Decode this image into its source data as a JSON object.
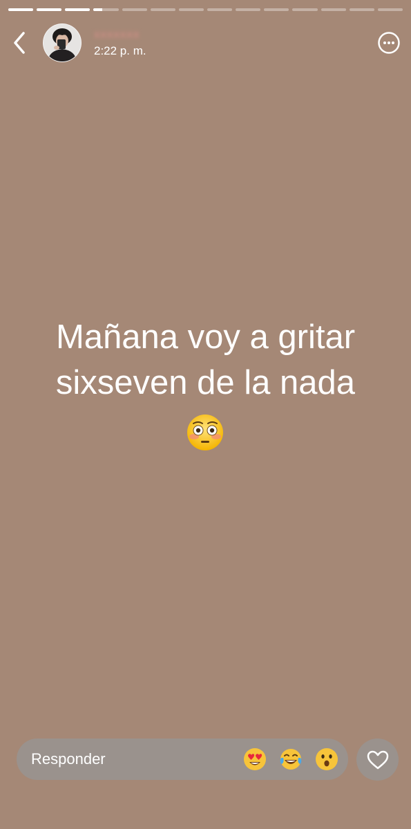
{
  "story": {
    "segments": [
      {
        "progress": 1
      },
      {
        "progress": 1
      },
      {
        "progress": 1
      },
      {
        "progress": 0.35
      },
      {
        "progress": 0
      },
      {
        "progress": 0
      },
      {
        "progress": 0
      },
      {
        "progress": 0
      },
      {
        "progress": 0
      },
      {
        "progress": 0
      },
      {
        "progress": 0
      },
      {
        "progress": 0
      },
      {
        "progress": 0
      },
      {
        "progress": 0
      }
    ],
    "background_color": "#a58876"
  },
  "header": {
    "username": "xxxxxxx",
    "timestamp": "2:22 p. m."
  },
  "content": {
    "line1": "Mañana voy a gritar",
    "line2": "sixseven de la nada",
    "emoji_icon": "flushed-face-icon"
  },
  "footer": {
    "reply_placeholder": "Responder",
    "reactions": [
      "heart-eyes-face-icon",
      "tears-of-joy-face-icon",
      "surprised-face-icon"
    ],
    "like_icon": "heart-outline-icon"
  }
}
